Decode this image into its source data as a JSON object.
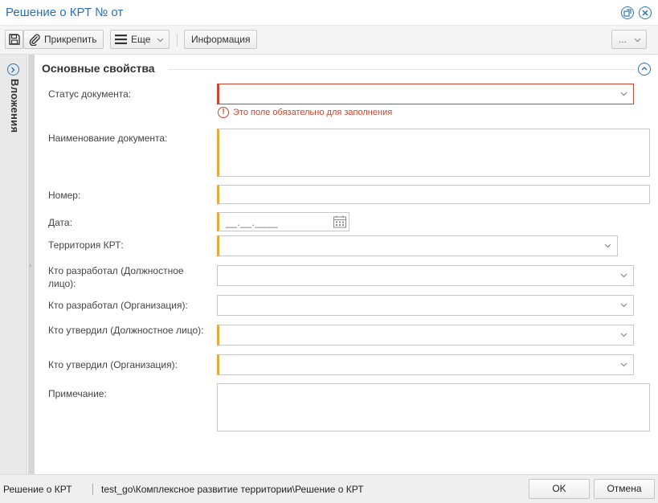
{
  "window": {
    "title": "Решение о КРТ № от"
  },
  "toolbar": {
    "attach_label": "Прикрепить",
    "more_label": "Еще",
    "info_label": "Информация",
    "overflow_label": "..."
  },
  "sidebar": {
    "tab_label": "Вложения"
  },
  "section": {
    "title": "Основные свойства"
  },
  "form": {
    "status": {
      "label": "Статус документа:",
      "value": "",
      "error": "Это поле обязательно для заполнения"
    },
    "doc_name": {
      "label": "Наименование документа:",
      "value": ""
    },
    "number": {
      "label": "Номер:",
      "value": ""
    },
    "date": {
      "label": "Дата:",
      "mask": "__.__.____"
    },
    "territory": {
      "label": "Территория КРТ:",
      "value": ""
    },
    "developed_person": {
      "label": "Кто разработал (Должностное лицо):",
      "value": ""
    },
    "developed_org": {
      "label": "Кто разработал (Организация):",
      "value": ""
    },
    "approved_person": {
      "label": "Кто утвердил (Должностное лицо):",
      "value": ""
    },
    "approved_org": {
      "label": "Кто утвердил (Организация):",
      "value": ""
    },
    "note": {
      "label": "Примечание:",
      "value": ""
    }
  },
  "statusbar": {
    "doc_type": "Решение о КРТ",
    "path": "test_go\\Комплексное развитие территории\\Решение о КРТ"
  },
  "footer": {
    "ok_label": "OK",
    "cancel_label": "Отмена"
  },
  "colors": {
    "accent": "#2f74b8",
    "required": "#e6a93a",
    "error": "#c8452f"
  }
}
